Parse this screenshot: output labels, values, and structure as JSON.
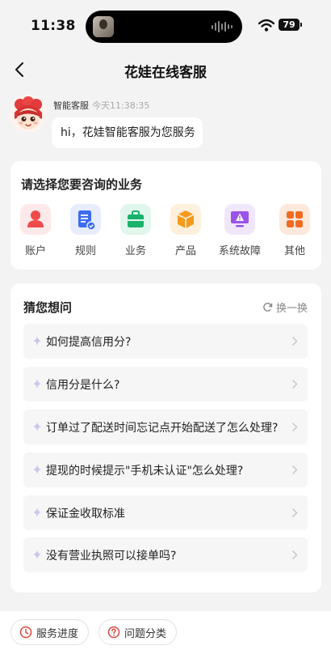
{
  "status_bar": {
    "time": "11:38",
    "battery": "79"
  },
  "nav": {
    "title": "花娃在线客服"
  },
  "chat": {
    "agent_name": "智能客服",
    "timestamp": "今天11:38:35",
    "message": "hi，花娃智能客服为您服务"
  },
  "service": {
    "title": "请选择您要咨询的业务",
    "categories": [
      {
        "label": "账户",
        "icon": "account-icon",
        "color": "#f04a4a",
        "bg": "#fde9ea"
      },
      {
        "label": "规则",
        "icon": "rules-document-icon",
        "color": "#3c6cf0",
        "bg": "#e7edfd"
      },
      {
        "label": "业务",
        "icon": "briefcase-icon",
        "color": "#17b36b",
        "bg": "#e1f6ec"
      },
      {
        "label": "产品",
        "icon": "product-box-icon",
        "color": "#f59a1c",
        "bg": "#fdf0dc"
      },
      {
        "label": "系统故障",
        "icon": "system-warning-icon",
        "color": "#9b52e8",
        "bg": "#f1e7fc"
      },
      {
        "label": "其他",
        "icon": "other-grid-icon",
        "color": "#f26a1f",
        "bg": "#fde8dc"
      }
    ]
  },
  "guess": {
    "title": "猜您想问",
    "refresh_label": "换一换",
    "questions": [
      "如何提高信用分?",
      "信用分是什么?",
      "订单过了配送时间忘记点开始配送了怎么处理?",
      "提现的时候提示\"手机未认证\"怎么处理?",
      "保证金收取标准",
      "没有营业执照可以接单吗?"
    ]
  },
  "bottom": {
    "progress_label": "服务进度",
    "category_label": "问题分类"
  }
}
